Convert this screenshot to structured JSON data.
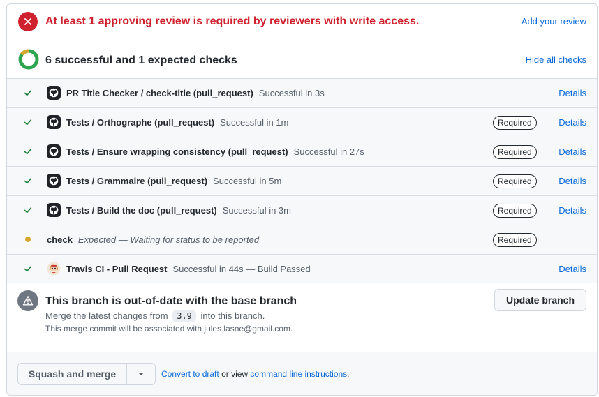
{
  "review": {
    "message": "At least 1 approving review is required by reviewers with write access.",
    "action": "Add your review",
    "icon": "x-circle-icon",
    "color": "#cf222e"
  },
  "checks": {
    "summary": "6 successful and 1 expected checks",
    "toggle": "Hide all checks",
    "items": [
      {
        "name": "PR Title Checker / check-title (pull_request)",
        "desc": "Successful in 3s",
        "required": "",
        "details": "Details"
      },
      {
        "name": "Tests / Orthographe (pull_request)",
        "desc": "Successful in 1m",
        "required": "Required",
        "details": "Details"
      },
      {
        "name": "Tests / Ensure wrapping consistency (pull_request)",
        "desc": "Successful in 27s",
        "required": "Required",
        "details": "Details"
      },
      {
        "name": "Tests / Grammaire (pull_request)",
        "desc": "Successful in 5m",
        "required": "Required",
        "details": "Details"
      },
      {
        "name": "Tests / Build the doc (pull_request)",
        "desc": "Successful in 3m",
        "required": "Required",
        "details": "Details"
      },
      {
        "name": "check",
        "desc": "Expected — Waiting for status to be reported",
        "required": "Required",
        "details": ""
      },
      {
        "name": "Travis CI - Pull Request",
        "desc": "Successful in 44s — Build Passed",
        "required": "",
        "details": "Details"
      }
    ]
  },
  "branch": {
    "title": "This branch is out-of-date with the base branch",
    "sub_prefix": "Merge the latest changes from",
    "base": "3.9",
    "sub_suffix": "into this branch.",
    "note": "This merge commit will be associated with jules.lasne@gmail.com.",
    "update_label": "Update branch"
  },
  "merge": {
    "button_label": "Squash and merge",
    "convert_link": "Convert to draft",
    "or_view": "or view",
    "cli_link": "command line instructions",
    "period": "."
  },
  "colors": {
    "success": "#1a7f37",
    "pending": "#d4a72c",
    "link": "#0969da",
    "error": "#cf222e"
  }
}
